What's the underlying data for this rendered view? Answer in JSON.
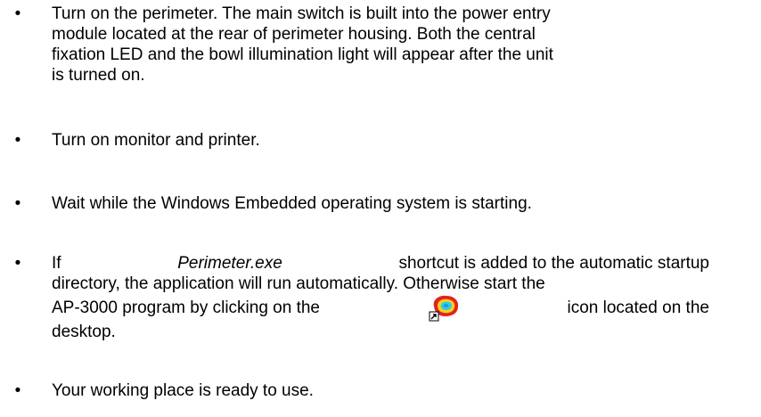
{
  "bullet_char": "•",
  "items": [
    {
      "lines": [
        "Turn on the perimeter. The main switch is built into the power entry",
        "module located at the rear of perimeter housing. Both the central",
        "fixation LED and the bowl illumination light will appear after the unit",
        "is turned on."
      ]
    },
    {
      "text": "Turn on monitor and printer."
    },
    {
      "text": "Wait while the Windows Embedded operating system is starting."
    },
    {
      "line1_italic": "Perimeter.exe",
      "line1_rest": "shortcut is added to the automatic startup",
      "line1_prefix": "If",
      "line2": "directory, the application will run automatically. Otherwise start the",
      "line3_before_icon": "AP-3000 program by clicking on the",
      "line3_after_icon": "icon located on the",
      "line4": "desktop.",
      "icon": "perimeter-shortcut-icon"
    },
    {
      "text": "Your working place is ready to use."
    }
  ]
}
